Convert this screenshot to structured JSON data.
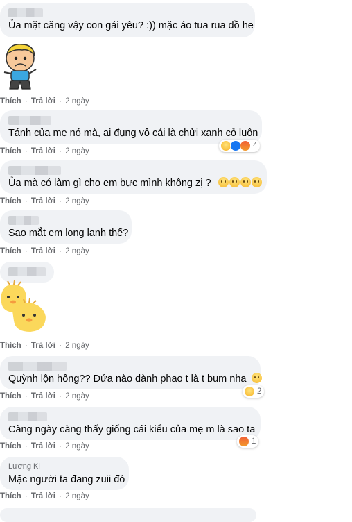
{
  "actions": {
    "like": "Thích",
    "reply": "Trả lời",
    "time": "2 ngày",
    "sep": "·"
  },
  "comments": [
    {
      "text": "Ủa mặt căng vậy con gái yêu? :)) mặc áo tua rua đồ he"
    },
    {
      "text": "Tánh của mẹ nó mà, ai đụng vô cái là chửi xanh cỏ luôn",
      "reactions": "4"
    },
    {
      "text": "Ủa mà có làm gì cho em bực mình không zị ?"
    },
    {
      "text": "Sao mắt em long lanh thế?"
    },
    {
      "text": ""
    },
    {
      "text": "Quỳnh lộn hông?? Đứa nào dành phao t là t bum nha",
      "reactions": "2"
    },
    {
      "text": "Càng ngày càng thấy giống cái kiểu của mẹ m là sao ta",
      "reactions": "1"
    },
    {
      "name": "Lương Ki  ",
      "text": "Mặc người ta đang zuii đó"
    }
  ],
  "icons": {
    "haha": "haha-reaction-icon",
    "angry": "angry-reaction-icon",
    "like": "like-reaction-icon"
  }
}
